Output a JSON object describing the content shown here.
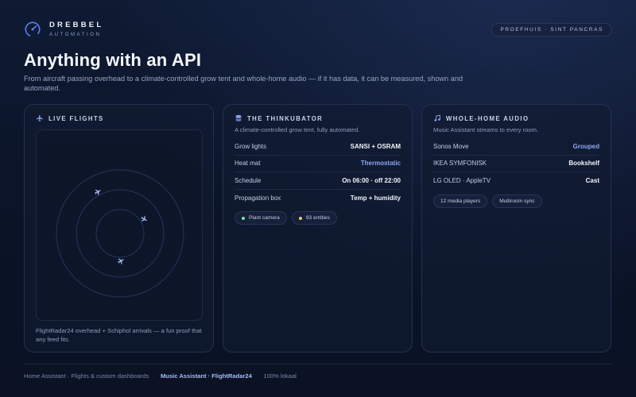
{
  "brand": {
    "name": "DREBBEL",
    "sub": "AUTOMATION",
    "accent": "#5b7cf0"
  },
  "location": "PROEFHUIS · SINT PANCRAS",
  "hero": {
    "title": "Anything with an API",
    "subtitle": "From aircraft passing overhead to a climate-controlled grow tent and whole-home audio — if it has data, it can be measured, shown and automated."
  },
  "flights": {
    "title": "LIVE FLIGHTS",
    "icon": "airplane-icon",
    "planes": 3,
    "caption": "FlightRadar24 overhead + Schiphol arrivals — a fun proof that any feed fits."
  },
  "thinkubator": {
    "title": "THE THINKUBATOR",
    "icon": "database-icon",
    "description": "A climate-controlled grow tent, fully automated.",
    "rows": [
      {
        "label": "Grow lights",
        "value": "SANSI + OSRAM"
      },
      {
        "label": "Heat mat",
        "value": "Thermostatic"
      },
      {
        "label": "Schedule",
        "value": "On 06:00 · off 22:00"
      },
      {
        "label": "Propagation box",
        "value": "Temp + humidity"
      }
    ],
    "chips": [
      {
        "label": "Plant camera",
        "dot": "#6ee7a8"
      },
      {
        "label": "93 entities",
        "dot": "#f2c46a"
      }
    ]
  },
  "audio": {
    "title": "WHOLE-HOME AUDIO",
    "icon": "music-note-icon",
    "description": "Music Assistant streams to every room.",
    "rows": [
      {
        "label": "Sonos Move",
        "value": "Grouped"
      },
      {
        "label": "IKEA SYMFONISK",
        "value": "Bookshelf"
      },
      {
        "label": "LG OLED · AppleTV",
        "value": "Cast"
      }
    ],
    "chips": [
      {
        "label": "12 media players"
      },
      {
        "label": "Multiroom sync"
      }
    ]
  },
  "footer": {
    "part1": "Home Assistant · Flights & custom dashboards",
    "part2": "Music Assistant · FlightRadar24",
    "part3": "100% lokaal"
  }
}
